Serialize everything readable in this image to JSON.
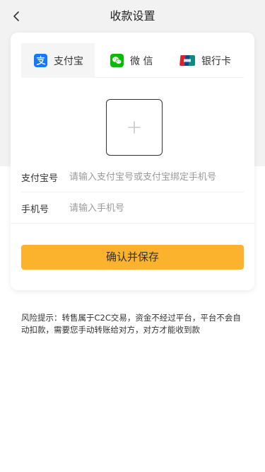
{
  "nav": {
    "title": "收款设置",
    "back_icon": "chevron-left-icon"
  },
  "tabs": [
    {
      "label": "支付宝",
      "icon": "alipay-icon",
      "icon_color": "#1677ff",
      "active": true
    },
    {
      "label": "微 信",
      "icon": "wechat-icon",
      "icon_color": "#09bb07",
      "active": false
    },
    {
      "label": "银行卡",
      "icon": "unionpay-icon",
      "icon_color": "#d8232a",
      "active": false
    }
  ],
  "upload": {
    "icon": "plus-icon"
  },
  "form": {
    "account": {
      "label": "支付宝号",
      "value": "",
      "placeholder": "请输入支付宝号或支付宝绑定手机号"
    },
    "phone": {
      "label": "手机号",
      "value": "",
      "placeholder": "请输入手机号"
    }
  },
  "submit": {
    "label": "确认并保存",
    "color": "#fbb32d"
  },
  "notice": "风险提示：转售属于C2C交易，资金不经过平台，平台不会自动扣款，需要您手动转账给对方，对方才能收到款"
}
